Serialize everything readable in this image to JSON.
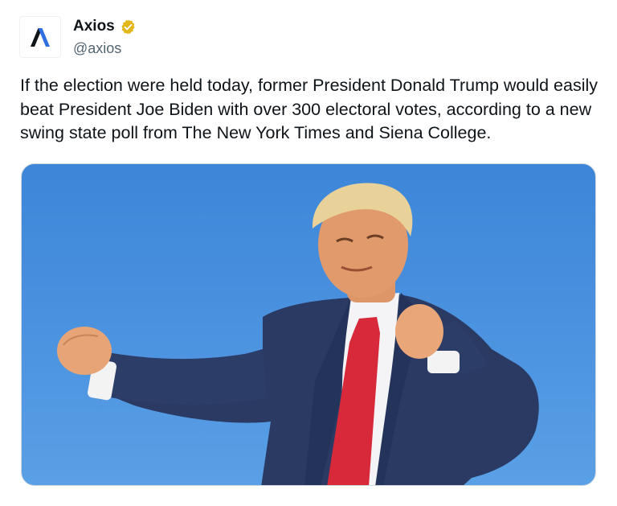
{
  "account": {
    "name": "Axios",
    "handle": "@axios",
    "verified": true,
    "avatar_icon": "axios-logo-icon",
    "badge_color": "#e2b719"
  },
  "tweet": {
    "text": "If the election were held today, former President Donald Trump would easily beat President Joe Biden with over 300 electoral votes, according to a new swing state poll from The New York Times and Siena College."
  },
  "media": {
    "type": "photo",
    "sky_color": "#4a90df",
    "suit_color": "#2a3a63",
    "tie_color": "#d8293a"
  }
}
